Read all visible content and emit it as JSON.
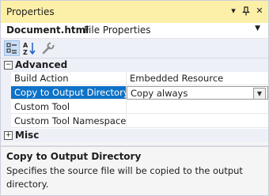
{
  "window": {
    "title": "Properties"
  },
  "titlebar_buttons": {
    "dropdown": "▾",
    "pin": "⊥",
    "close": "✕"
  },
  "object_selector": {
    "name": "Document.html",
    "type": "File Properties"
  },
  "toolbar": {
    "items": [
      {
        "icon": "categorized-icon",
        "active": true
      },
      {
        "icon": "alphabetical-icon",
        "active": false
      },
      {
        "icon": "property-pages-wrench-icon",
        "active": false
      }
    ]
  },
  "categories": [
    {
      "label": "Advanced",
      "expander": "−",
      "properties": [
        {
          "name": "Build Action",
          "value": "Embedded Resource"
        },
        {
          "name": "Copy to Output Directory",
          "value": "Copy always",
          "selected": true
        },
        {
          "name": "Custom Tool",
          "value": ""
        },
        {
          "name": "Custom Tool Namespace",
          "value": ""
        }
      ]
    },
    {
      "label": "Misc",
      "expander": "+"
    }
  ],
  "description": {
    "title": "Copy to Output Directory",
    "text": "Specifies the source file will be copied to the output directory."
  },
  "colors": {
    "title_bar": "#fcf0a8",
    "selection": "#0e72c7"
  }
}
